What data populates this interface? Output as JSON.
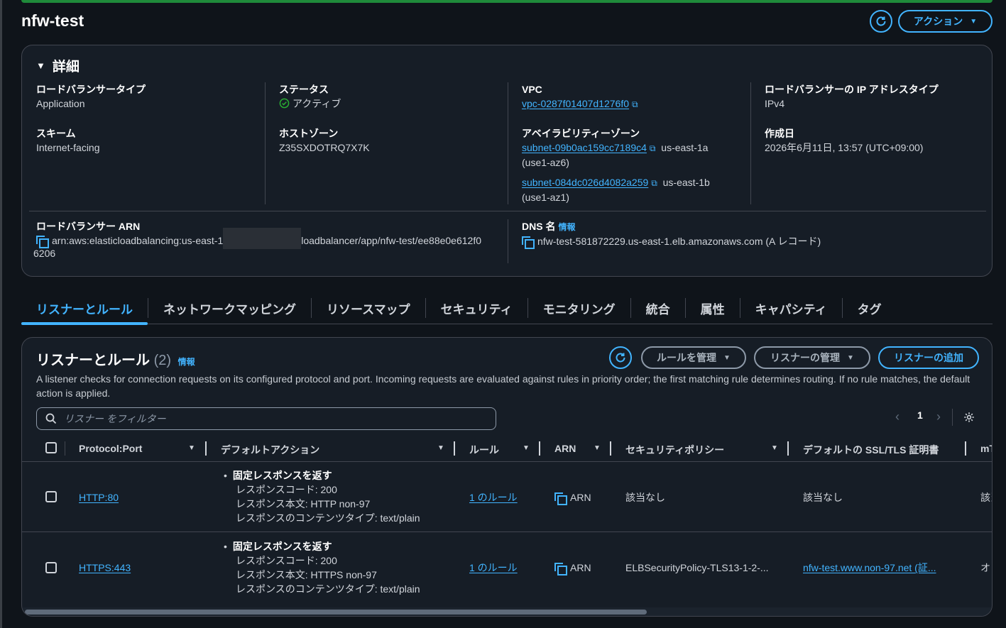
{
  "page": {
    "title": "nfw-test",
    "actions_label": "アクション"
  },
  "details": {
    "header": "詳細",
    "lb_type": {
      "label": "ロードバランサータイプ",
      "value": "Application"
    },
    "status": {
      "label": "ステータス",
      "value": "アクティブ"
    },
    "vpc": {
      "label": "VPC",
      "value": "vpc-0287f01407d1276f0"
    },
    "ip_type": {
      "label": "ロードバランサーの IP アドレスタイプ",
      "value": "IPv4"
    },
    "scheme": {
      "label": "スキーム",
      "value": "Internet-facing"
    },
    "hosted_zone": {
      "label": "ホストゾーン",
      "value": "Z35SXDOTRQ7X7K"
    },
    "az": {
      "label": "アベイラビリティーゾーン",
      "items": [
        {
          "subnet": "subnet-09b0ac159cc7189c4",
          "zone": "us-east-1a",
          "az_id": "(use1-az6)"
        },
        {
          "subnet": "subnet-084dc026d4082a259",
          "zone": "us-east-1b",
          "az_id": "(use1-az1)"
        }
      ]
    },
    "created": {
      "label": "作成日",
      "value": "2026年6月11日, 13:57 (UTC+09:00)"
    },
    "arn": {
      "label": "ロードバランサー ARN",
      "prefix": "arn:aws:elasticloadbalancing:us-east-1",
      "suffix": "loadbalancer/app/nfw-test/ee88e0e612f0",
      "line2": "6206"
    },
    "dns": {
      "label": "DNS 名",
      "info": "情報",
      "value": "nfw-test-581872229.us-east-1.elb.amazonaws.com (A レコード)"
    }
  },
  "tabs": [
    "リスナーとルール",
    "ネットワークマッピング",
    "リソースマップ",
    "セキュリティ",
    "モニタリング",
    "統合",
    "属性",
    "キャパシティ",
    "タグ"
  ],
  "listeners": {
    "title": "リスナーとルール",
    "count": "(2)",
    "info": "情報",
    "manage_rules": "ルールを管理",
    "manage_listeners": "リスナーの管理",
    "add_listener": "リスナーの追加",
    "description": "A listener checks for connection requests on its configured protocol and port. Incoming requests are evaluated against rules in priority order; the first matching rule determines routing. If no rule matches, the default action is applied.",
    "search_placeholder": "リスナー をフィルター",
    "page": "1",
    "columns": [
      "Protocol:Port",
      "デフォルトアクション",
      "ルール",
      "ARN",
      "セキュリティポリシー",
      "デフォルトの SSL/TLS 証明書",
      "mT"
    ],
    "rows": [
      {
        "protocol_port": "HTTP:80",
        "action_title": "固定レスポンスを返す",
        "action_lines": [
          "レスポンスコード: 200",
          "レスポンス本文: HTTP non-97",
          "レスポンスのコンテンツタイプ: text/plain"
        ],
        "rules": "1 のルール",
        "arn": "ARN",
        "policy": "該当なし",
        "cert": "該当なし",
        "mtls": "該当"
      },
      {
        "protocol_port": "HTTPS:443",
        "action_title": "固定レスポンスを返す",
        "action_lines": [
          "レスポンスコード: 200",
          "レスポンス本文: HTTPS non-97",
          "レスポンスのコンテンツタイプ: text/plain"
        ],
        "rules": "1 のルール",
        "arn": "ARN",
        "policy": "ELBSecurityPolicy-TLS13-1-2-...",
        "cert": "nfw-test.www.non-97.net (証...",
        "mtls": "オフ"
      }
    ]
  },
  "colors": {
    "accent": "#42b4ff",
    "success": "#29ad32",
    "background": "#0f141a",
    "panel": "#161d26"
  },
  "icons": [
    "refresh-icon",
    "caret-down-icon",
    "external-link-icon",
    "copy-icon",
    "search-icon",
    "settings-icon",
    "check-circle-icon"
  ]
}
